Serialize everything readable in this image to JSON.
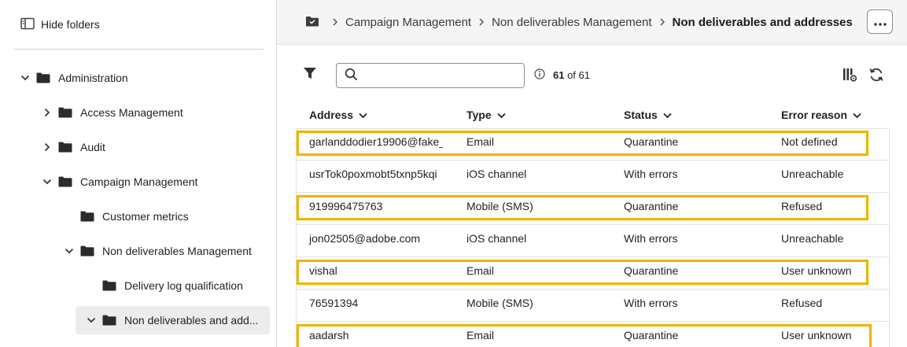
{
  "sidebar": {
    "hide_folders_label": "Hide folders",
    "tree": [
      {
        "label": "Administration",
        "chevron": "down",
        "name": "tree-item-administration"
      },
      {
        "label": "Access Management",
        "chevron": "right",
        "name": "tree-item-access-management"
      },
      {
        "label": "Audit",
        "chevron": "right",
        "name": "tree-item-audit"
      },
      {
        "label": "Campaign Management",
        "chevron": "down",
        "name": "tree-item-campaign-management"
      },
      {
        "label": "Customer metrics",
        "chevron": "none",
        "name": "tree-item-customer-metrics"
      },
      {
        "label": "Non deliverables Management",
        "chevron": "down",
        "name": "tree-item-non-deliverables-management"
      },
      {
        "label": "Delivery log qualification",
        "chevron": "none",
        "name": "tree-item-delivery-log-qualification"
      },
      {
        "label": "Non deliverables and add...",
        "chevron": "down",
        "name": "tree-item-non-deliverables-and-addresses",
        "selected": true
      }
    ]
  },
  "breadcrumb": {
    "items": [
      "Campaign Management",
      "Non deliverables Management"
    ],
    "current": "Non deliverables and addresses"
  },
  "toolbar": {
    "search_placeholder": "",
    "count_current": "61",
    "count_text": " of 61"
  },
  "table": {
    "columns": [
      "Address",
      "Type",
      "Status",
      "Error reason"
    ],
    "rows": [
      {
        "address": "garlanddodier19906@fake_...",
        "type": "Email",
        "status": "Quarantine",
        "reason": "Not defined",
        "highlighted": true
      },
      {
        "address": "usrTok0poxmobt5txnp5kqi",
        "type": "iOS channel",
        "status": "With errors",
        "reason": "Unreachable",
        "highlighted": false
      },
      {
        "address": "919996475763",
        "type": "Mobile (SMS)",
        "status": "Quarantine",
        "reason": "Refused",
        "highlighted": true
      },
      {
        "address": "jon02505@adobe.com",
        "type": "iOS channel",
        "status": "With errors",
        "reason": "Unreachable",
        "highlighted": false
      },
      {
        "address": "vishal",
        "type": "Email",
        "status": "Quarantine",
        "reason": "User unknown",
        "highlighted": true
      },
      {
        "address": "76591394",
        "type": "Mobile (SMS)",
        "status": "With errors",
        "reason": "Refused",
        "highlighted": false
      },
      {
        "address": "aadarsh",
        "type": "Email",
        "status": "Quarantine",
        "reason": "User unknown",
        "highlighted": true
      }
    ]
  },
  "colors": {
    "highlight": "#f0b400",
    "topbar_bg": "#f5f5f5",
    "selected_bg": "#ececec"
  }
}
